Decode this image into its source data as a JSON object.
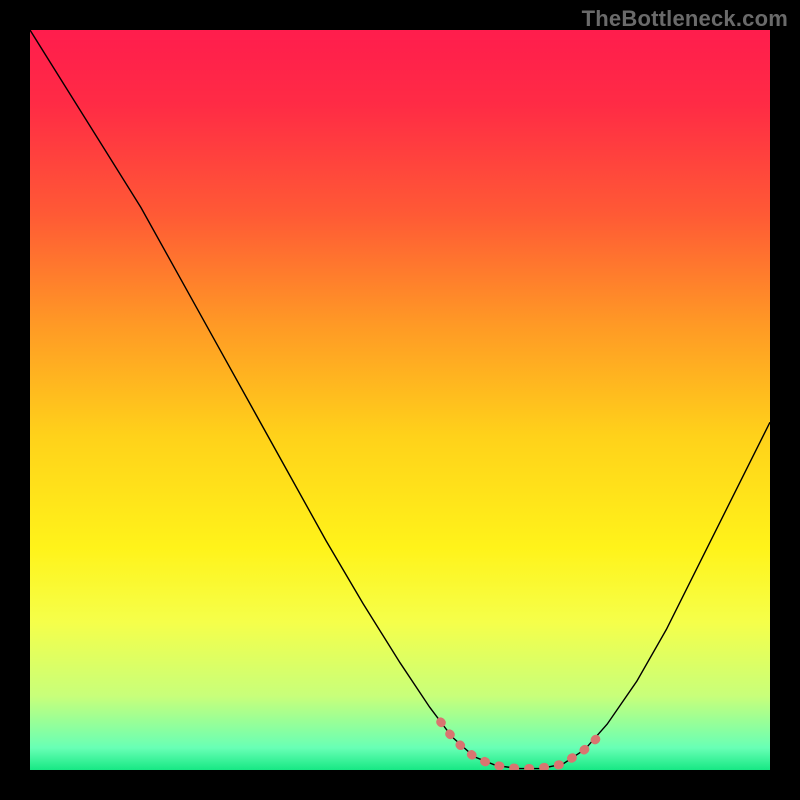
{
  "watermark": "TheBottleneck.com",
  "chart_data": {
    "type": "line",
    "title": "",
    "xlabel": "",
    "ylabel": "",
    "xlim": [
      0,
      100
    ],
    "ylim": [
      0,
      100
    ],
    "background_gradient": {
      "stops": [
        {
          "offset": 0.0,
          "color": "#ff1d4d"
        },
        {
          "offset": 0.1,
          "color": "#ff2b45"
        },
        {
          "offset": 0.25,
          "color": "#ff5a35"
        },
        {
          "offset": 0.4,
          "color": "#ff9a25"
        },
        {
          "offset": 0.55,
          "color": "#ffd21a"
        },
        {
          "offset": 0.7,
          "color": "#fff31a"
        },
        {
          "offset": 0.8,
          "color": "#f5ff4a"
        },
        {
          "offset": 0.9,
          "color": "#c8ff7a"
        },
        {
          "offset": 0.97,
          "color": "#68ffb5"
        },
        {
          "offset": 1.0,
          "color": "#17e884"
        }
      ]
    },
    "series": [
      {
        "name": "curve",
        "color": "#000000",
        "width": 1.4,
        "points": [
          {
            "x": 0.0,
            "y": 100.0
          },
          {
            "x": 5.0,
            "y": 92.0
          },
          {
            "x": 10.0,
            "y": 84.0
          },
          {
            "x": 15.0,
            "y": 76.0
          },
          {
            "x": 20.0,
            "y": 67.0
          },
          {
            "x": 25.0,
            "y": 58.0
          },
          {
            "x": 30.0,
            "y": 49.0
          },
          {
            "x": 35.0,
            "y": 40.0
          },
          {
            "x": 40.0,
            "y": 31.0
          },
          {
            "x": 45.0,
            "y": 22.5
          },
          {
            "x": 50.0,
            "y": 14.5
          },
          {
            "x": 54.0,
            "y": 8.5
          },
          {
            "x": 57.0,
            "y": 4.5
          },
          {
            "x": 60.0,
            "y": 1.8
          },
          {
            "x": 63.0,
            "y": 0.6
          },
          {
            "x": 66.0,
            "y": 0.2
          },
          {
            "x": 69.0,
            "y": 0.2
          },
          {
            "x": 72.0,
            "y": 0.8
          },
          {
            "x": 75.0,
            "y": 2.8
          },
          {
            "x": 78.0,
            "y": 6.2
          },
          {
            "x": 82.0,
            "y": 12.0
          },
          {
            "x": 86.0,
            "y": 19.0
          },
          {
            "x": 90.0,
            "y": 27.0
          },
          {
            "x": 95.0,
            "y": 37.0
          },
          {
            "x": 100.0,
            "y": 47.0
          }
        ]
      },
      {
        "name": "highlight",
        "color": "#d97570",
        "width": 9.0,
        "dash": "1 14",
        "linecap": "round",
        "points": [
          {
            "x": 55.5,
            "y": 6.5
          },
          {
            "x": 57.0,
            "y": 4.5
          },
          {
            "x": 58.5,
            "y": 3.0
          },
          {
            "x": 60.0,
            "y": 1.8
          },
          {
            "x": 62.0,
            "y": 0.9
          },
          {
            "x": 64.0,
            "y": 0.4
          },
          {
            "x": 66.0,
            "y": 0.2
          },
          {
            "x": 68.0,
            "y": 0.2
          },
          {
            "x": 70.0,
            "y": 0.4
          },
          {
            "x": 72.0,
            "y": 0.8
          },
          {
            "x": 73.5,
            "y": 1.8
          },
          {
            "x": 75.0,
            "y": 2.8
          },
          {
            "x": 76.5,
            "y": 4.2
          }
        ]
      }
    ]
  }
}
